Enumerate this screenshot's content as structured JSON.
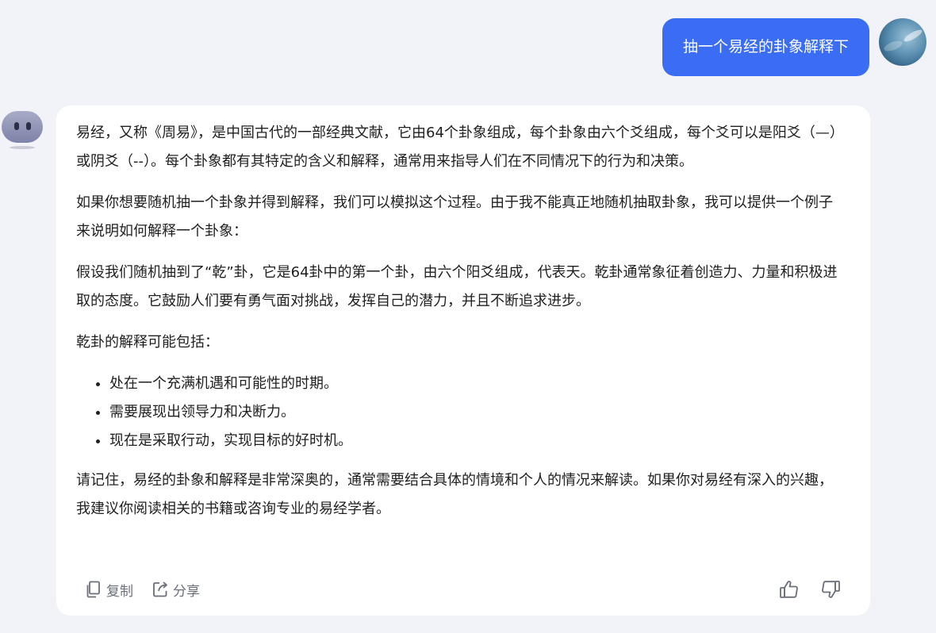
{
  "user_message": {
    "text": "抽一个易经的卦象解释下",
    "avatar_icon": "user-avatar-photo"
  },
  "bot": {
    "avatar_icon": "bot-avatar"
  },
  "answer": {
    "paragraphs": [
      "易经，又称《周易》，是中国古代的一部经典文献，它由64个卦象组成，每个卦象由六个爻组成，每个爻可以是阳爻（—）或阴爻（--）。每个卦象都有其特定的含义和解释，通常用来指导人们在不同情况下的行为和决策。",
      "如果你想要随机抽一个卦象并得到解释，我们可以模拟这个过程。由于我不能真正地随机抽取卦象，我可以提供一个例子来说明如何解释一个卦象：",
      "假设我们随机抽到了“乾”卦，它是64卦中的第一个卦，由六个阳爻组成，代表天。乾卦通常象征着创造力、力量和积极进取的态度。它鼓励人们要有勇气面对挑战，发挥自己的潜力，并且不断追求进步。",
      "乾卦的解释可能包括："
    ],
    "bullets": [
      "处在一个充满机遇和可能性的时期。",
      "需要展现出领导力和决断力。",
      "现在是采取行动，实现目标的好时机。"
    ],
    "closing": "请记住，易经的卦象和解释是非常深奥的，通常需要结合具体的情境和个人的情况来解读。如果你对易经有深入的兴趣，我建议你阅读相关的书籍或咨询专业的易经学者。"
  },
  "actions": {
    "copy_label": "复制",
    "share_label": "分享",
    "copy_icon": "copy-icon",
    "share_icon": "share-icon",
    "like_icon": "thumbs-up-icon",
    "dislike_icon": "thumbs-down-icon"
  },
  "colors": {
    "background": "#f1f3f9",
    "user_bubble": "#3a6cf4",
    "card": "#ffffff",
    "action_text": "#6b6f7a"
  }
}
